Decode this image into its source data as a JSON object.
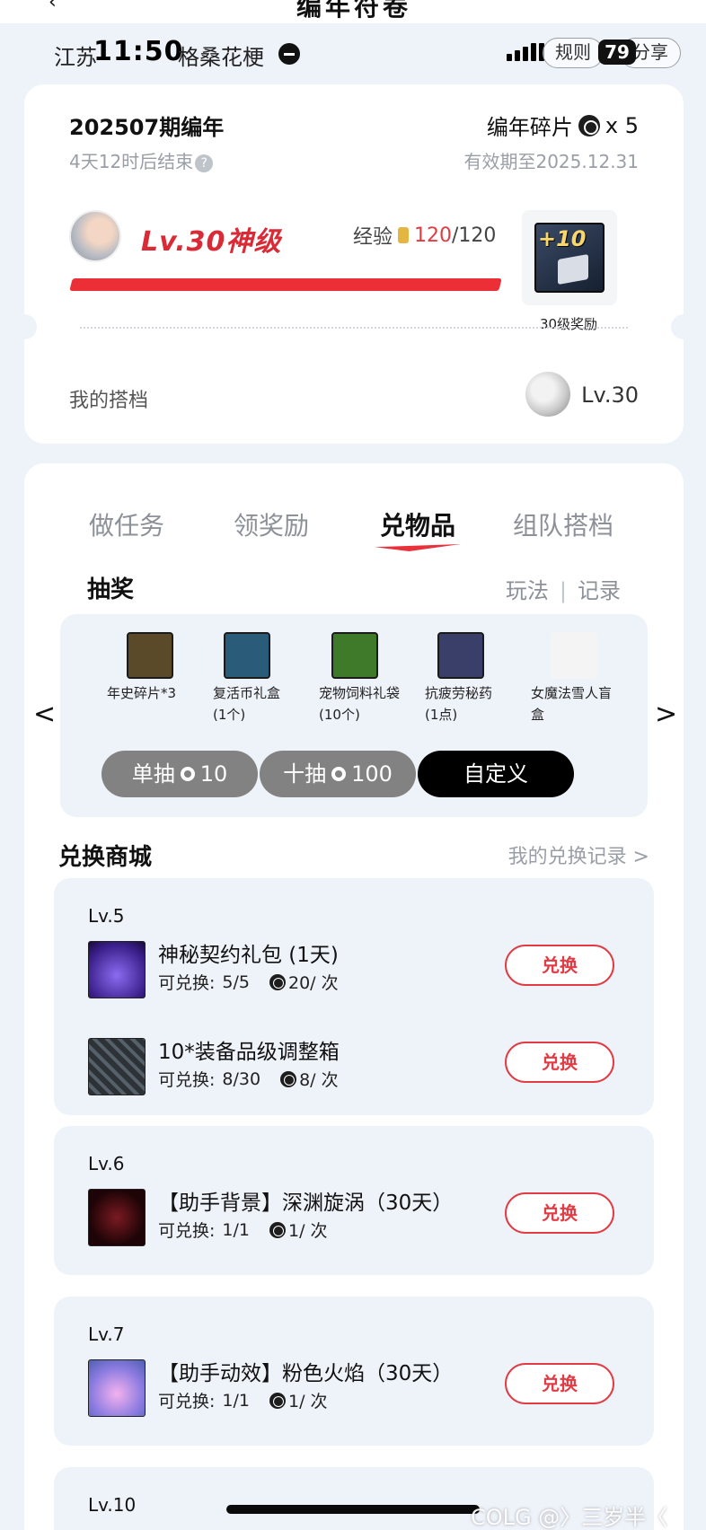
{
  "header": {
    "title": "编年符卷",
    "back_icon": "back-arrow-icon"
  },
  "status": {
    "location": "江苏",
    "time": "11:50",
    "carrier_text": "格桑花梗",
    "rules_label": "规则",
    "battery": "79",
    "share_label": "分享"
  },
  "season": {
    "title": "202507期编年",
    "ends": "4天12时后结束",
    "help": "?",
    "fragment_label": "编年碎片",
    "fragment_count": "x 5",
    "validity": "有效期至2025.12.31"
  },
  "progress": {
    "level": "Lv.30神级",
    "exp_label": "经验",
    "exp_current": "120",
    "exp_total": "/120",
    "exp_fraction": 1.0,
    "reward_tag": "+10",
    "reward_caption": "30级奖励"
  },
  "partner": {
    "label": "我的搭档",
    "level": "Lv.30"
  },
  "tabs": [
    {
      "label": "做任务",
      "active": false
    },
    {
      "label": "领奖励",
      "active": false
    },
    {
      "label": "兑物品",
      "active": true
    },
    {
      "label": "组队搭档",
      "active": false
    }
  ],
  "lottery": {
    "title": "抽奖",
    "link_play": "玩法",
    "link_sep": "|",
    "link_record": "记录",
    "prev": "<",
    "next": ">",
    "prizes": [
      {
        "line1": "年史碎片*3",
        "line2": "",
        "color": "#5b4a2a"
      },
      {
        "line1": "复活币礼盒",
        "line2": "(1个)",
        "color": "#2a5c7a"
      },
      {
        "line1": "宠物饲料礼袋",
        "line2": "(10个)",
        "color": "#3f7a2a"
      },
      {
        "line1": "抗疲劳秘药",
        "line2": "(1点)",
        "color": "#3a3f6a"
      },
      {
        "line1": "女魔法雪人盲",
        "line2": "盒",
        "color": "#f4f4f4"
      }
    ],
    "single": {
      "label": "单抽",
      "cost": "10"
    },
    "ten": {
      "label": "十抽",
      "cost": "100"
    },
    "custom": {
      "label": "自定义"
    }
  },
  "shop": {
    "title": "兑换商城",
    "record_link": "我的兑换记录 >",
    "exchange_label": "兑换",
    "avail_prefix": "可兑换:",
    "groups": [
      {
        "level": "Lv.5",
        "items": [
          {
            "name": "神秘契约礼包 (1天)",
            "available": "5/5",
            "cost": "20/ 次",
            "color": "#5b3bb5"
          },
          {
            "name": "10*装备品级调整箱",
            "available": "8/30",
            "cost": "8/ 次",
            "color": "#3e4448"
          }
        ]
      },
      {
        "level": "Lv.6",
        "items": [
          {
            "name": "【助手背景】深渊旋涡（30天）",
            "available": "1/1",
            "cost": "1/ 次",
            "color": "#3b0c10"
          }
        ]
      },
      {
        "level": "Lv.7",
        "items": [
          {
            "name": "【助手动效】粉色火焰（30天）",
            "available": "1/1",
            "cost": "1/ 次",
            "color": "#6b7fd6"
          }
        ]
      },
      {
        "level": "Lv.10",
        "items": []
      }
    ]
  },
  "watermark": "COLG @〉三岁半〈"
}
